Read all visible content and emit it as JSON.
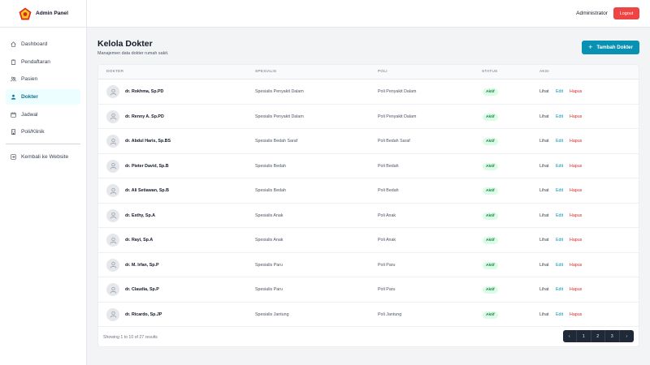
{
  "brand": {
    "title": "Admin Panel"
  },
  "sidebar": {
    "items": [
      {
        "label": "Dashboard",
        "icon": "home-icon"
      },
      {
        "label": "Pendaftaran",
        "icon": "clipboard-icon"
      },
      {
        "label": "Pasien",
        "icon": "users-icon"
      },
      {
        "label": "Dokter",
        "icon": "user-doctor-icon",
        "active": true
      },
      {
        "label": "Jadwal",
        "icon": "calendar-icon"
      },
      {
        "label": "Poli/Klinik",
        "icon": "building-icon"
      }
    ],
    "back_label": "Kembali ke Website"
  },
  "header": {
    "user": "Administrator",
    "logout_label": "Logout"
  },
  "page": {
    "title": "Kelola Dokter",
    "subtitle": "Manajemen data dokter rumah sakit.",
    "add_button_label": "Tambah Dokter",
    "add_button_icon": "+"
  },
  "table": {
    "headers": {
      "dokter": "DOKTER",
      "spesialis": "SPESIALIS",
      "poli": "POLI",
      "status": "STATUS",
      "aksi": "AKSI"
    },
    "actions": {
      "view": "Lihat",
      "edit": "Edit",
      "delete": "Hapus"
    },
    "rows": [
      {
        "name": "dr. Rokhma, Sp.PD",
        "spesialis": "Spesialis Penyakit Dalam",
        "poli": "Poli Penyakit Dalam",
        "status": "Aktif"
      },
      {
        "name": "dr. Renny A. Sp.PD",
        "spesialis": "Spesialis Penyakit Dalam",
        "poli": "Poli Penyakit Dalam",
        "status": "Aktif"
      },
      {
        "name": "dr. Abdul Haris, Sp.BS",
        "spesialis": "Spesialis Bedah Saraf",
        "poli": "Poli Bedah Saraf",
        "status": "Aktif"
      },
      {
        "name": "dr. Pieter David, Sp.B",
        "spesialis": "Spesialis Bedah",
        "poli": "Poli Bedah",
        "status": "Aktif"
      },
      {
        "name": "dr. Ali Setiawan, Sp.B",
        "spesialis": "Spesialis Bedah",
        "poli": "Poli Bedah",
        "status": "Aktif"
      },
      {
        "name": "dr. Esthy, Sp.A",
        "spesialis": "Spesialis Anak",
        "poli": "Poli Anak",
        "status": "Aktif"
      },
      {
        "name": "dr. Rayi, Sp.A",
        "spesialis": "Spesialis Anak",
        "poli": "Poli Anak",
        "status": "Aktif"
      },
      {
        "name": "dr. M. Irfan, Sp.P",
        "spesialis": "Spesialis Paru",
        "poli": "Poli Paru",
        "status": "Aktif"
      },
      {
        "name": "dr. Claudia, Sp.P",
        "spesialis": "Spesialis Paru",
        "poli": "Poli Paru",
        "status": "Aktif"
      },
      {
        "name": "dr. Ricardo, Sp.JP",
        "spesialis": "Spesialis Jantung",
        "poli": "Poli Jantung",
        "status": "Aktif"
      }
    ],
    "footer": "Showing 1 to 10 of 27 results"
  },
  "pagination": {
    "prev": "‹",
    "pages": [
      "1",
      "2",
      "3"
    ],
    "next": "›"
  },
  "colors": {
    "accent": "#0891b2",
    "danger": "#ef4444",
    "success_bg": "#dcfce7",
    "success_text": "#15803d",
    "pager_bg": "#1f2937"
  }
}
